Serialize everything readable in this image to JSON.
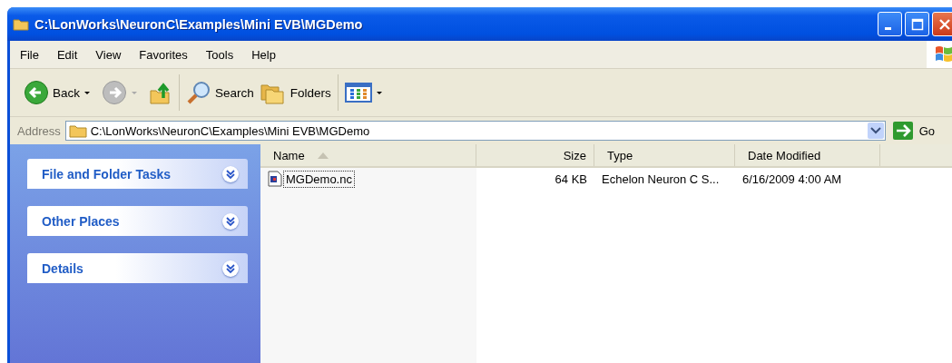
{
  "window": {
    "title": "C:\\LonWorks\\NeuronC\\Examples\\Mini EVB\\MGDemo"
  },
  "menu": [
    "File",
    "Edit",
    "View",
    "Favorites",
    "Tools",
    "Help"
  ],
  "toolbar": [
    {
      "kind": "back",
      "label": "Back",
      "disabled": false,
      "dropdown": true
    },
    {
      "kind": "forward",
      "disabled": true,
      "dropdown": true
    },
    {
      "kind": "up"
    },
    {
      "kind": "separator"
    },
    {
      "kind": "search",
      "label": "Search"
    },
    {
      "kind": "folders",
      "label": "Folders"
    },
    {
      "kind": "separator"
    },
    {
      "kind": "views",
      "dropdown": true
    }
  ],
  "address": {
    "label": "Address",
    "value": "C:\\LonWorks\\NeuronC\\Examples\\Mini EVB\\MGDemo",
    "go_label": "Go"
  },
  "sidebar": {
    "panels": [
      {
        "title": "File and Folder Tasks",
        "expanded": false
      },
      {
        "title": "Other Places",
        "expanded": false
      },
      {
        "title": "Details",
        "expanded": false
      }
    ]
  },
  "table": {
    "columns": [
      {
        "label": "Name",
        "sorted": true
      },
      {
        "label": "Size"
      },
      {
        "label": "Type"
      },
      {
        "label": "Date Modified"
      }
    ],
    "rows": [
      {
        "name": "MGDemo.nc",
        "size": "64 KB",
        "type": "Echelon Neuron C S...",
        "modified": "6/16/2009 4:00 AM",
        "focused": true
      }
    ]
  }
}
